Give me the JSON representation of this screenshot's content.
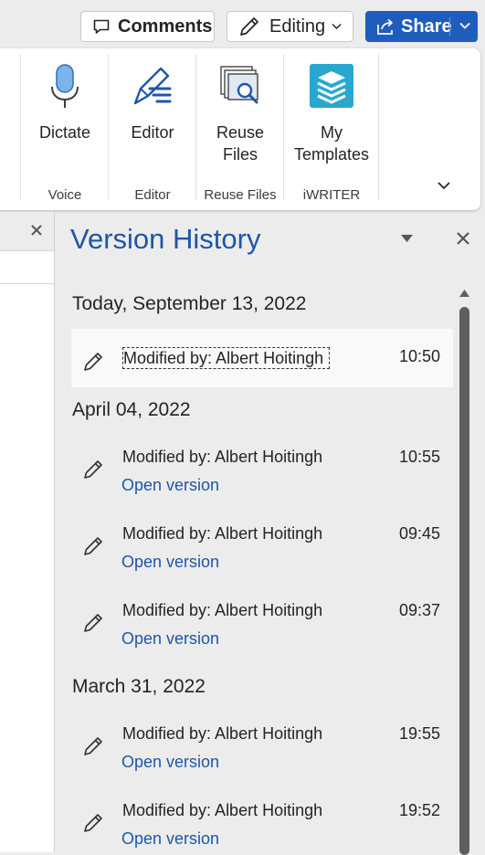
{
  "toolbar": {
    "comments_label": "Comments",
    "editing_label": "Editing",
    "share_label": "Share"
  },
  "ribbon": {
    "groups": [
      {
        "label": "Voice",
        "buttons": [
          {
            "label": "Dictate",
            "icon": "microphone-icon"
          }
        ]
      },
      {
        "label": "Editor",
        "buttons": [
          {
            "label": "Editor",
            "icon": "editor-pen-icon"
          }
        ]
      },
      {
        "label": "Reuse Files",
        "buttons": [
          {
            "label": "Reuse\nFiles",
            "icon": "reuse-files-icon"
          }
        ]
      },
      {
        "label": "iWRITER",
        "buttons": [
          {
            "label": "My\nTemplates",
            "icon": "iwriter-templates-icon"
          }
        ]
      }
    ]
  },
  "version_history": {
    "title": "Version History",
    "sections": [
      {
        "date": "Today, September 13, 2022",
        "entries": [
          {
            "modified_by": "Modified by: Albert Hoitingh",
            "time": "10:50",
            "open_label": ""
          }
        ]
      },
      {
        "date": "April 04, 2022",
        "entries": [
          {
            "modified_by": "Modified by: Albert Hoitingh",
            "time": "10:55",
            "open_label": "Open version"
          },
          {
            "modified_by": "Modified by: Albert Hoitingh",
            "time": "09:45",
            "open_label": "Open version"
          },
          {
            "modified_by": "Modified by: Albert Hoitingh",
            "time": "09:37",
            "open_label": "Open version"
          }
        ]
      },
      {
        "date": "March 31, 2022",
        "entries": [
          {
            "modified_by": "Modified by: Albert Hoitingh",
            "time": "19:55",
            "open_label": "Open version"
          },
          {
            "modified_by": "Modified by: Albert Hoitingh",
            "time": "19:52",
            "open_label": "Open version"
          }
        ]
      }
    ]
  },
  "colors": {
    "accent_blue": "#1e56a8",
    "share_button": "#1f5dbd",
    "pane_background": "#ececec"
  }
}
